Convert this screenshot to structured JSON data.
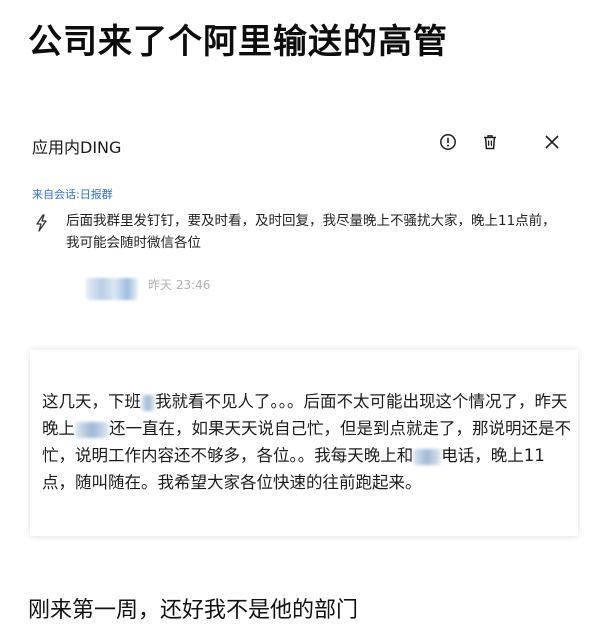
{
  "headline": "公司来了个阿里输送的高管",
  "ding_card": {
    "title": "应用内DING",
    "from": "来自会话:日报群",
    "message": "后面我群里发钉钉，要及时看，及时回复，我尽量晚上不骚扰大家，晚上11点前，我可能会随时微信各位",
    "time": "昨天 23:46",
    "icons": [
      "info-icon",
      "trash-icon",
      "close-icon",
      "bolt-icon"
    ]
  },
  "chat_card": {
    "seg1": "这几天，下班",
    "seg2": "我就看不见人了。。。后面不太可能出现这个情况了，昨天晚上",
    "seg3": "还一直在，如果天天说自己忙，但是到点就走了，那说明还是不忙，说明工作内容还不够多，各位。。我每天晚上和",
    "seg4": "电话，晚上11点，随叫随在。我希望大家各位快速的往前跑起来。"
  },
  "caption": "刚来第一周，还好我不是他的部门"
}
